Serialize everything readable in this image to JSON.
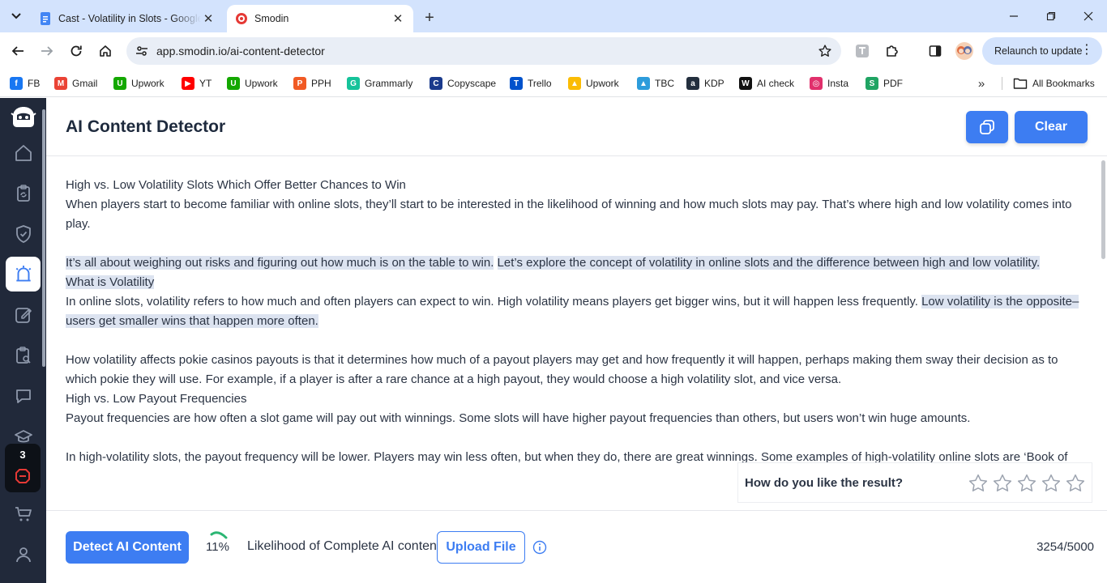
{
  "browser": {
    "tabs": [
      {
        "title": "Cast - Volatility in Slots - Google Docs",
        "active": false
      },
      {
        "title": "Smodin",
        "active": true
      }
    ],
    "url": "app.smodin.io/ai-content-detector",
    "relaunch_label": "Relaunch to update",
    "bookmarks": [
      {
        "label": "FB",
        "icon": "facebook-icon",
        "color": "#1877f2"
      },
      {
        "label": "Gmail",
        "icon": "gmail-icon",
        "color": "#ea4335"
      },
      {
        "label": "Upwork",
        "icon": "upwork-icon",
        "color": "#14a800"
      },
      {
        "label": "YT",
        "icon": "youtube-icon",
        "color": "#ff0000"
      },
      {
        "label": "Upwork",
        "icon": "upwork-icon",
        "color": "#14a800"
      },
      {
        "label": "PPH",
        "icon": "pph-icon",
        "color": "#f15a24"
      },
      {
        "label": "Grammarly",
        "icon": "grammarly-icon",
        "color": "#15c39a"
      },
      {
        "label": "Copyscape",
        "icon": "copyscape-icon",
        "color": "#1a3a8c"
      },
      {
        "label": "Trello",
        "icon": "trello-icon",
        "color": "#0052cc"
      },
      {
        "label": "Upwork",
        "icon": "google-drive-icon",
        "color": "#fbbc04"
      },
      {
        "label": "TBC",
        "icon": "tbc-icon",
        "color": "#2d9cdb"
      },
      {
        "label": "KDP",
        "icon": "kdp-icon",
        "color": "#232f3e"
      },
      {
        "label": "AI check",
        "icon": "ai-check-icon",
        "color": "#111111"
      },
      {
        "label": "Insta",
        "icon": "instagram-icon",
        "color": "#e1306c"
      },
      {
        "label": "PDF",
        "icon": "pdf-icon",
        "color": "#1fa463"
      }
    ],
    "all_bookmarks_label": "All Bookmarks"
  },
  "sidebar": {
    "badge_count": "3"
  },
  "header": {
    "title": "AI Content Detector",
    "clear_label": "Clear"
  },
  "editor": {
    "l1": "High vs. Low Volatility Slots Which Offer Better Chances to Win",
    "l2": "When players start to become familiar with online slots, they’ll start to be interested in the likelihood of winning and how much slots may pay. That’s where high and low volatility comes into play.",
    "h1": "It’s all about weighing out risks and figuring out how much is on the table to win.",
    "h2": "Let’s explore the concept of volatility in online slots and the difference between high and low volatility.",
    "h3": "What is Volatility",
    "l3": "In online slots, volatility refers to how much and often players can expect to win. High volatility means players get bigger wins, but it will happen less frequently.",
    "h4": "Low volatility is the opposite–users get smaller wins that happen more often.",
    "l4": "How volatility affects pokie casinos payouts is that it determines how much of a payout players may get and how frequently it will happen, perhaps making them sway their decision as to which pokie they will use. For example, if a player is after a rare chance at a high payout, they would choose a high volatility slot, and vice versa.",
    "l5": "High vs. Low Payout Frequencies",
    "l6": "Payout frequencies are how often a slot game will pay out with winnings. Some slots will have higher payout frequencies than others, but users won’t win huge amounts.",
    "l7": "In high-volatility slots, the payout frequency will be lower. Players may win less often, but when they do, there are great winnings. Some examples of high-volatility online slots are ‘Book of"
  },
  "rating": {
    "question": "How do you like the result?",
    "stars": 5
  },
  "footer": {
    "detect_label": "Detect AI Content",
    "percent": "11%",
    "percent_value": 0.11,
    "likelihood_label": "Likelihood of Complete AI content",
    "upload_label": "Upload File",
    "char_count": "3254/5000"
  },
  "colors": {
    "accent": "#3d7df2",
    "sidebar_bg": "#21293a",
    "highlight": "#dce3f0",
    "progress": "#2bb673"
  }
}
